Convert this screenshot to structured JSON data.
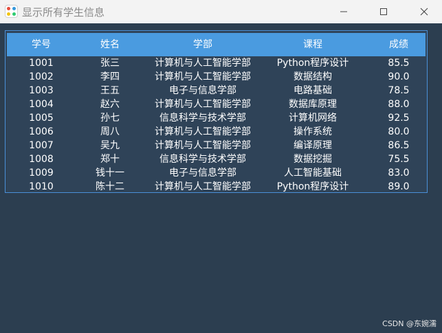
{
  "window": {
    "title": "显示所有学生信息",
    "controls": {
      "minimize_icon": "minimize-icon",
      "maximize_icon": "maximize-icon",
      "close_icon": "close-icon"
    }
  },
  "colors": {
    "background": "#2c3e50",
    "table_body": "#2f4358",
    "header": "#4a9be0",
    "border": "#4a90d9",
    "text": "#ffffff"
  },
  "table": {
    "headers": [
      "学号",
      "姓名",
      "学部",
      "课程",
      "成绩"
    ],
    "rows": [
      [
        "1001",
        "张三",
        "计算机与人工智能学部",
        "Python程序设计",
        "85.5"
      ],
      [
        "1002",
        "李四",
        "计算机与人工智能学部",
        "数据结构",
        "90.0"
      ],
      [
        "1003",
        "王五",
        "电子与信息学部",
        "电路基础",
        "78.5"
      ],
      [
        "1004",
        "赵六",
        "计算机与人工智能学部",
        "数据库原理",
        "88.0"
      ],
      [
        "1005",
        "孙七",
        "信息科学与技术学部",
        "计算机网络",
        "92.5"
      ],
      [
        "1006",
        "周八",
        "计算机与人工智能学部",
        "操作系统",
        "80.0"
      ],
      [
        "1007",
        "吴九",
        "计算机与人工智能学部",
        "编译原理",
        "86.5"
      ],
      [
        "1008",
        "郑十",
        "信息科学与技术学部",
        "数据挖掘",
        "75.5"
      ],
      [
        "1009",
        "钱十一",
        "电子与信息学部",
        "人工智能基础",
        "83.0"
      ],
      [
        "1010",
        "陈十二",
        "计算机与人工智能学部",
        "Python程序设计",
        "89.0"
      ]
    ]
  },
  "watermark": "CSDN @东婉濡"
}
